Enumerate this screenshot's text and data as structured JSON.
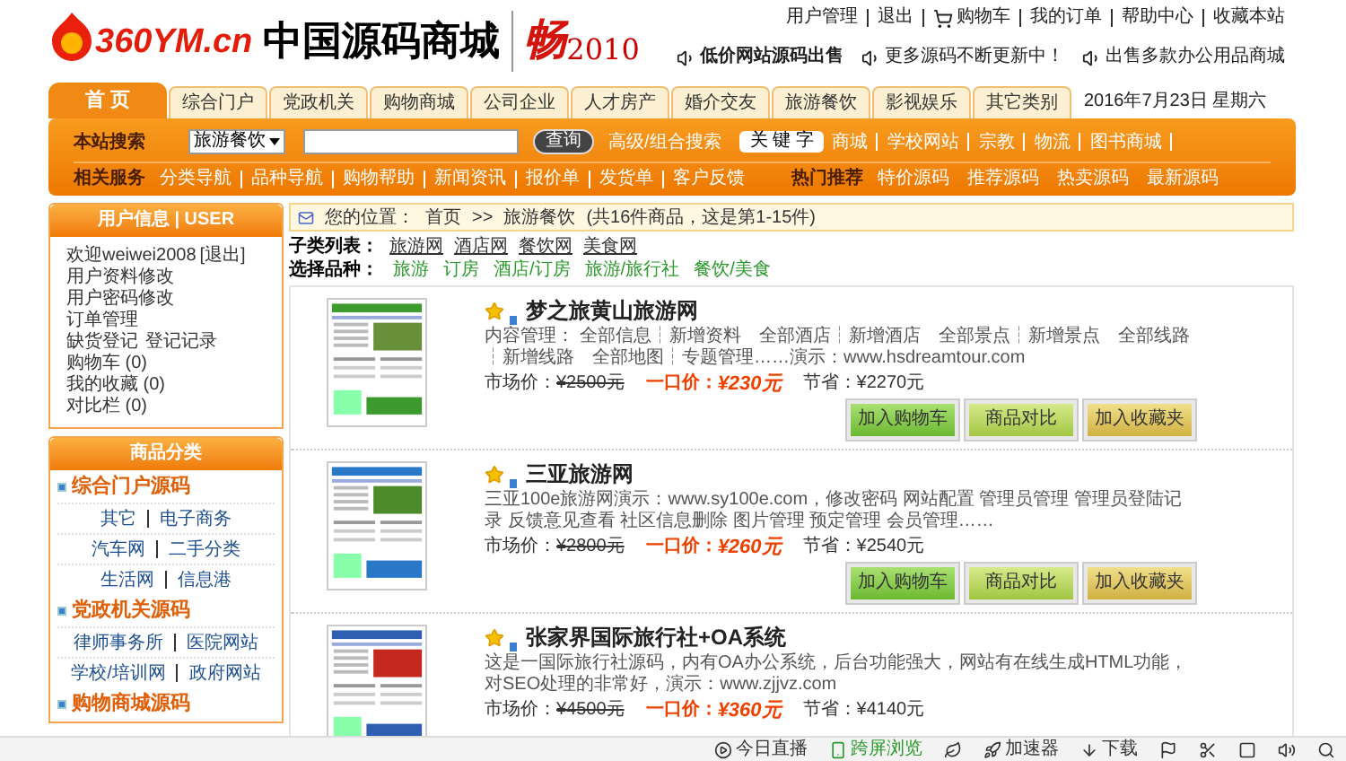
{
  "header": {
    "logo_text": "360YM.cn",
    "site_title": "中国源码商城",
    "banner": {
      "calligraphy": "畅",
      "year": "2010"
    },
    "top_links": [
      "用户管理",
      "退出",
      "购物车",
      "我的订单",
      "帮助中心",
      "收藏本站"
    ],
    "notices": [
      "低价网站源码出售",
      "更多源码不断更新中！",
      "出售多款办公用品商城"
    ]
  },
  "nav": {
    "tabs": [
      {
        "label": "首 页",
        "selected": true
      },
      {
        "label": "综合门户",
        "selected": false
      },
      {
        "label": "党政机关",
        "selected": false
      },
      {
        "label": "购物商城",
        "selected": false
      },
      {
        "label": "公司企业",
        "selected": false
      },
      {
        "label": "人才房产",
        "selected": false
      },
      {
        "label": "婚介交友",
        "selected": false
      },
      {
        "label": "旅游餐饮",
        "selected": false
      },
      {
        "label": "影视娱乐",
        "selected": false
      },
      {
        "label": "其它类别",
        "selected": false
      }
    ],
    "date": "2016年7月23日 星期六"
  },
  "search": {
    "label": "本站搜索",
    "category": "旅游餐饮",
    "button": "查询",
    "advanced_link": "高级/组合搜索",
    "keyword_label": "关 键 字",
    "keywords": [
      "商城",
      "学校网站",
      "宗教",
      "物流",
      "图书商城"
    ]
  },
  "services": {
    "label": "相关服务",
    "links": [
      "分类导航",
      "品种导航",
      "购物帮助",
      "新闻资讯",
      "报价单",
      "发货单",
      "客户反馈"
    ],
    "hot_label": "热门推荐",
    "hot_links": [
      "特价源码",
      "推荐源码",
      "热卖源码",
      "最新源码"
    ]
  },
  "sidebar": {
    "user_panel": {
      "title": "用户信息 | USER",
      "welcome": "欢迎weiwei2008",
      "logout": "[退出]",
      "lines": [
        {
          "links": [
            "用户资料修改"
          ]
        },
        {
          "links": [
            "用户密码修改"
          ]
        },
        {
          "links": [
            "订单管理"
          ]
        },
        {
          "links": [
            "缺货登记",
            "登记记录"
          ]
        },
        {
          "links": [
            "购物车 (0)"
          ]
        },
        {
          "links": [
            "我的收藏 (0)"
          ]
        },
        {
          "links": [
            "对比栏 (0)"
          ]
        }
      ]
    },
    "categories": {
      "title": "商品分类",
      "groups": [
        {
          "name": "综合门户源码",
          "rows": [
            [
              "其它",
              "电子商务"
            ],
            [
              "汽车网",
              "二手分类"
            ],
            [
              "生活网",
              "信息港"
            ]
          ]
        },
        {
          "name": "党政机关源码",
          "rows": [
            [
              "律师事务所",
              "医院网站"
            ],
            [
              "学校/培训网",
              "政府网站"
            ]
          ]
        },
        {
          "name": "购物商城源码"
        }
      ]
    }
  },
  "main": {
    "breadcrumb": {
      "label": "您的位置：",
      "home": "首页",
      "separator": ">>",
      "current": "旅游餐饮",
      "count": "(共16件商品，这是第1-15件)"
    },
    "subcategories": {
      "label": "子类列表：",
      "items": [
        "旅游网",
        "酒店网",
        "餐饮网",
        "美食网"
      ]
    },
    "varieties": {
      "label": "选择品种：",
      "items": [
        "旅游",
        "订房",
        "酒店/订房",
        "旅游/旅行社",
        "餐饮/美食"
      ]
    },
    "products": [
      {
        "name": "梦之旅黄山旅游网",
        "description": "内容管理： 全部信息┆新增资料　全部酒店┆新增酒店　全部景点┆新增景点　全部线路┆新增线路　全部地图┆专题管理……演示：www.hsdreamtour.com",
        "market_label": "市场价：",
        "market_price": "¥2500元",
        "price_label": "一口价：",
        "price": "¥230元",
        "saving_label": "节省：",
        "saving": "¥2270元",
        "buttons": [
          "加入购物车",
          "商品对比",
          "加入收藏夹"
        ]
      },
      {
        "name": "三亚旅游网",
        "description": "三亚100e旅游网演示：www.sy100e.com，修改密码 网站配置 管理员管理 管理员登陆记录 反馈意见查看 社区信息删除 图片管理 预定管理 会员管理……",
        "market_label": "市场价：",
        "market_price": "¥2800元",
        "price_label": "一口价：",
        "price": "¥260元",
        "saving_label": "节省：",
        "saving": "¥2540元",
        "buttons": [
          "加入购物车",
          "商品对比",
          "加入收藏夹"
        ]
      },
      {
        "name": "张家界国际旅行社+OA系统",
        "description": "这是一国际旅行社源码，内有OA办公系统，后台功能强大，网站有在线生成HTML功能，对SEO处理的非常好，演示：www.zjjvz.com",
        "market_label": "市场价：",
        "market_price": "¥4500元",
        "price_label": "一口价：",
        "price": "¥360元",
        "saving_label": "节省：",
        "saving": "¥4140元"
      }
    ]
  },
  "status_bar": {
    "items": [
      "今日直播",
      "跨屏浏览",
      "加速器",
      "下载"
    ]
  }
}
